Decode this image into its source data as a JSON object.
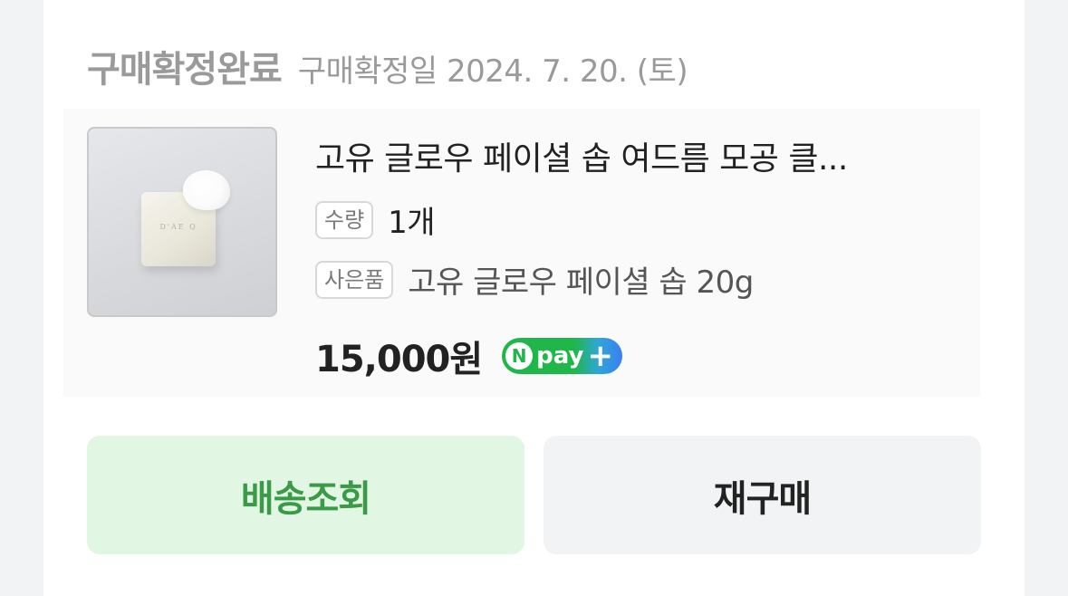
{
  "order": {
    "status": "구매확정완료",
    "confirm_date": "구매확정일 2024. 7. 20. (토)"
  },
  "product": {
    "image_brand_text": "D'AE Q",
    "name": "고유 글로우 페이셜 솝 여드름 모공 클...",
    "quantity_label": "수량",
    "quantity_value": "1개",
    "gift_label": "사은품",
    "gift_value": "고유 글로우 페이셜 솝 20g",
    "price": "15,000원",
    "npay_badge": {
      "n": "N",
      "text": "pay",
      "plus": "+"
    }
  },
  "actions": {
    "track_delivery": "배송조회",
    "rebuy": "재구매"
  },
  "colors": {
    "track_bg": "#e1f7e4",
    "track_text": "#3a9a47",
    "rebuy_bg": "#f2f3f5",
    "npay_green": "#1fb74a",
    "npay_blue": "#3a7ff0"
  },
  "icons": {
    "npay": "npay-plus-icon"
  }
}
